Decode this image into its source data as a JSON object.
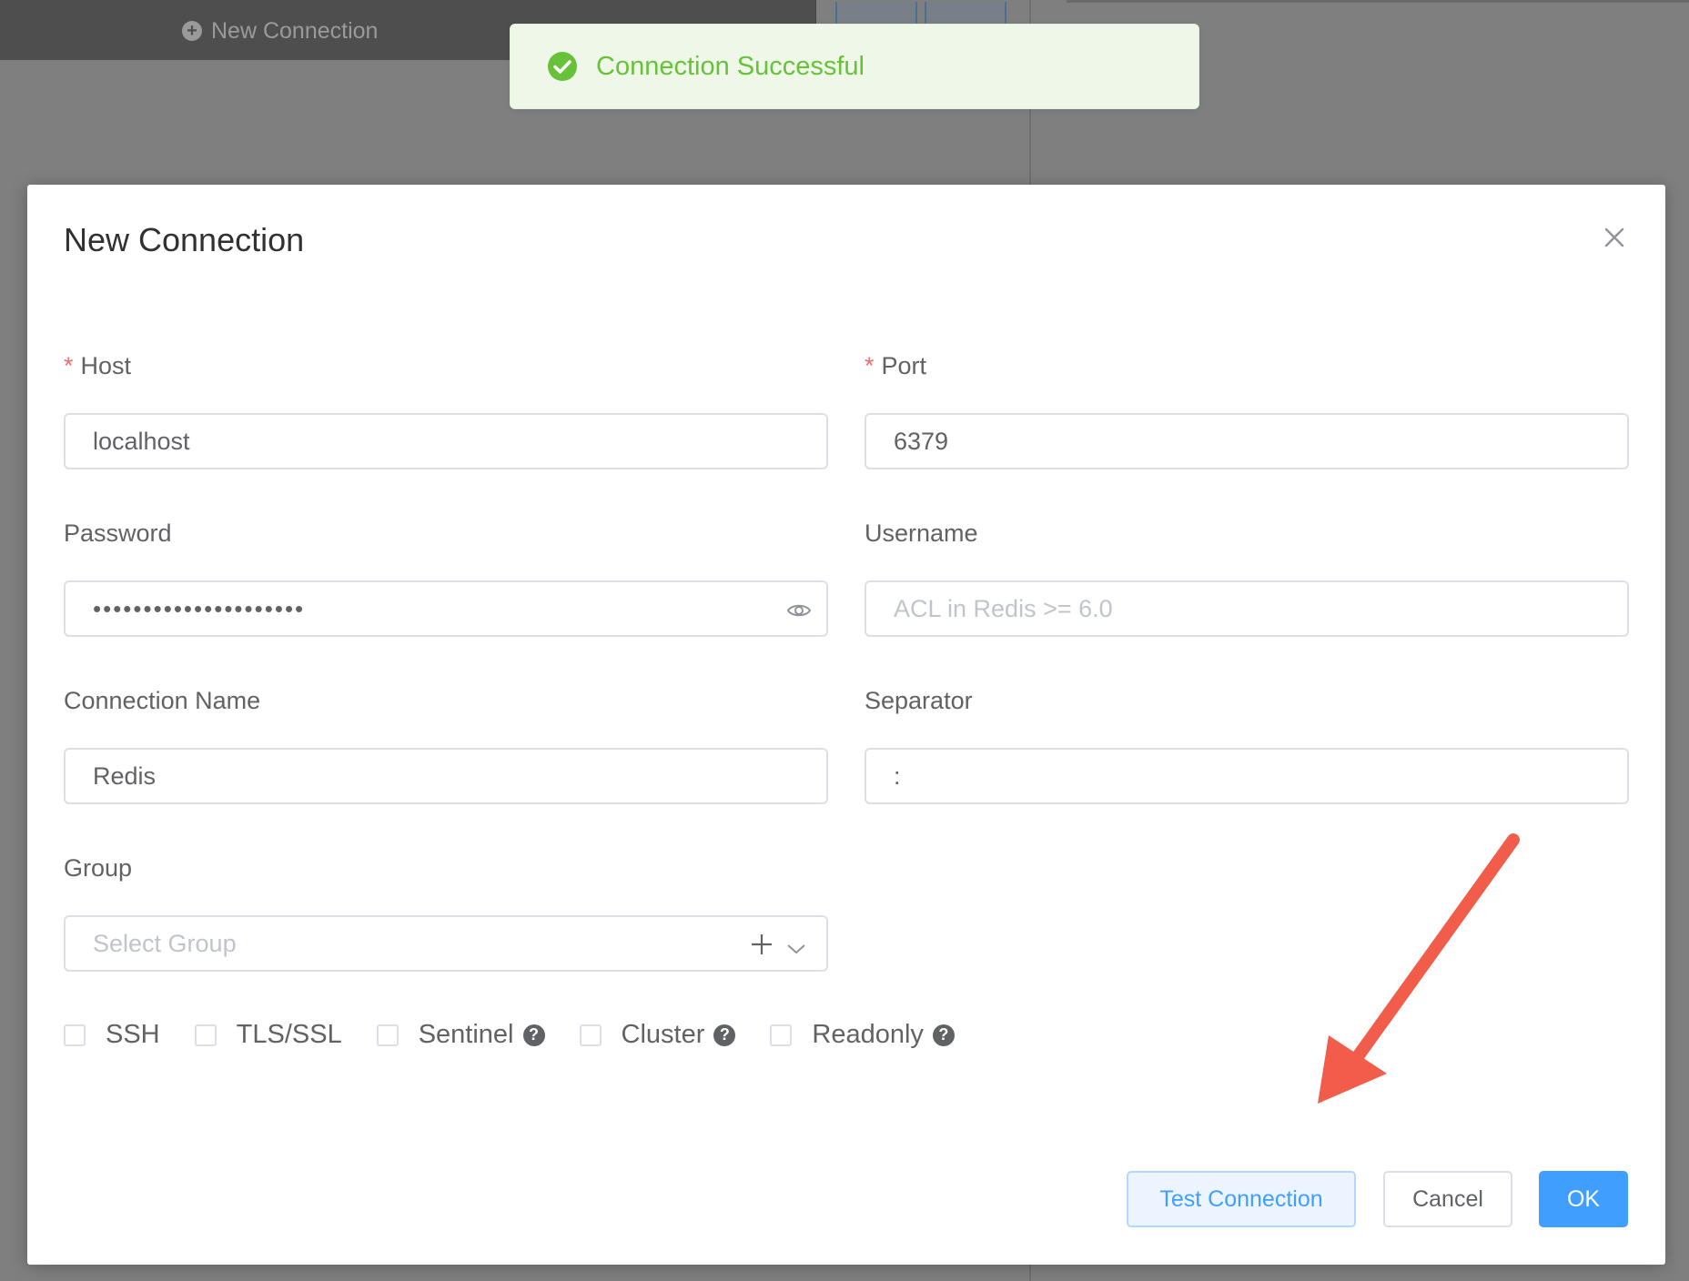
{
  "background": {
    "new_connection_label": "New Connection"
  },
  "toast": {
    "message": "Connection Successful"
  },
  "dialog": {
    "title": "New Connection",
    "host": {
      "label": "Host",
      "required_mark": "*",
      "value": "localhost"
    },
    "port": {
      "label": "Port",
      "required_mark": "*",
      "value": "6379"
    },
    "password": {
      "label": "Password",
      "masked_value": "•••••••••••••••••••••"
    },
    "username": {
      "label": "Username",
      "placeholder": "ACL in Redis >= 6.0"
    },
    "connection_name": {
      "label": "Connection Name",
      "value": "Redis"
    },
    "separator": {
      "label": "Separator",
      "value": ":"
    },
    "group": {
      "label": "Group",
      "placeholder": "Select Group"
    },
    "options": [
      {
        "label": "SSH",
        "checked": false,
        "help": false
      },
      {
        "label": "TLS/SSL",
        "checked": false,
        "help": false
      },
      {
        "label": "Sentinel",
        "checked": false,
        "help": true
      },
      {
        "label": "Cluster",
        "checked": false,
        "help": true
      },
      {
        "label": "Readonly",
        "checked": false,
        "help": true
      }
    ],
    "buttons": {
      "test": "Test Connection",
      "cancel": "Cancel",
      "ok": "OK"
    }
  },
  "colors": {
    "primary": "#409eff",
    "success": "#67c23a",
    "required": "#f56c6c",
    "annotation_arrow": "#f25c4a"
  }
}
